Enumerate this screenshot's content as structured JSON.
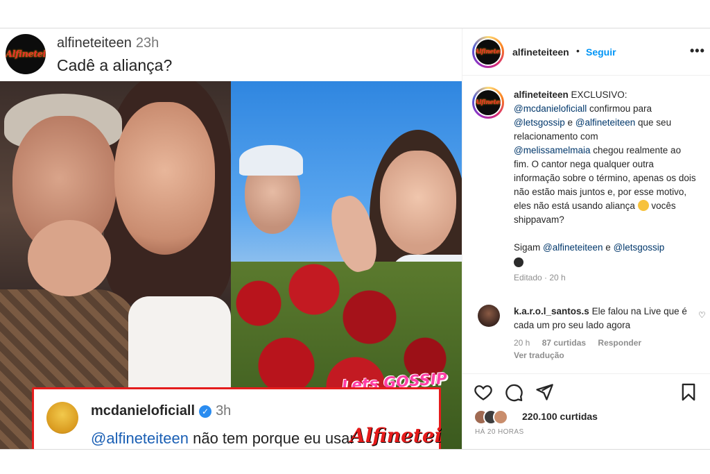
{
  "post": {
    "header": {
      "username": "alfineteiteen",
      "time": "23h",
      "caption": "Cadê a aliança?"
    },
    "embedded_comment": {
      "username": "mcdanieloficiall",
      "verified_icon": "verified-badge-icon",
      "time": "3h",
      "mention": "@alfineteiteen",
      "text": " não tem porque eu usar aliança ."
    },
    "logo_text": "Alfinetei",
    "overlay_tag_gossip": "Lets GOSSIP",
    "overlay_tag_alfinetei": "Alfinetei"
  },
  "panel": {
    "header": {
      "username": "alfineteiteen",
      "separator": "•",
      "follow_label": "Seguir",
      "more_icon": "more-icon"
    },
    "caption": {
      "username": "alfineteiteen",
      "line_intro": " EXCLUSIVO:",
      "mention1": "@mcdanieloficiall",
      "text1": " confirmou para",
      "mention2": "@letsgossip",
      "text2": " e ",
      "mention3": "@alfineteiteen",
      "text3": " que seu relacionamento com",
      "mention4": "@melissamelmaia",
      "text4": " chegou realmente ao fim. O cantor nega qualquer outra informação sobre o término, apenas os dois não estão mais juntos e, por esse motivo, eles não está usando aliança ",
      "text5": " vocês shippavam?",
      "follow_line_prefix": "Sigam ",
      "follow_mention1": "@alfineteiteen",
      "follow_mid": " e ",
      "follow_mention2": "@letsgossip",
      "edited": "Editado · 20 h"
    },
    "comment": {
      "username": "k.a.r.o.l_santos.s",
      "text": " Ele falou na Live que é cada um pro seu lado agora",
      "time": "20 h",
      "likes": "87 curtidas",
      "reply": "Responder",
      "translate": "Ver tradução"
    },
    "actions": {
      "like_icon": "heart-icon",
      "comment_icon": "comment-icon",
      "share_icon": "share-icon",
      "save_icon": "bookmark-icon",
      "likes_count": "220.100 curtidas",
      "age": "HÁ 20 HORAS"
    }
  }
}
